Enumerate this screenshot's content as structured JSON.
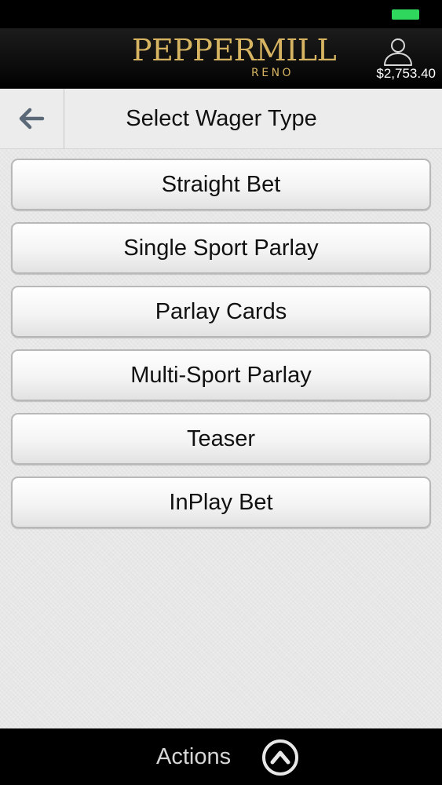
{
  "colors": {
    "brand_gold": "#d6b461",
    "battery": "#2fd85c",
    "header_bg": "#0a0a0a",
    "bottom_bar_bg": "#000000",
    "page_bg": "#e7e7e7"
  },
  "status_bar": {
    "battery_icon": "battery-icon"
  },
  "header": {
    "logo_main": "PEPPERMILL",
    "logo_sub": "RENO",
    "user_icon": "user-icon",
    "balance": "$2,753.40"
  },
  "title_bar": {
    "back_icon": "arrow-left-icon",
    "title": "Select Wager Type"
  },
  "wager_types": [
    {
      "label": "Straight Bet"
    },
    {
      "label": "Single Sport Parlay"
    },
    {
      "label": "Parlay Cards"
    },
    {
      "label": "Multi-Sport Parlay"
    },
    {
      "label": "Teaser"
    },
    {
      "label": "InPlay Bet"
    }
  ],
  "bottom_bar": {
    "actions_label": "Actions",
    "actions_icon": "chevron-up-circle-icon"
  }
}
